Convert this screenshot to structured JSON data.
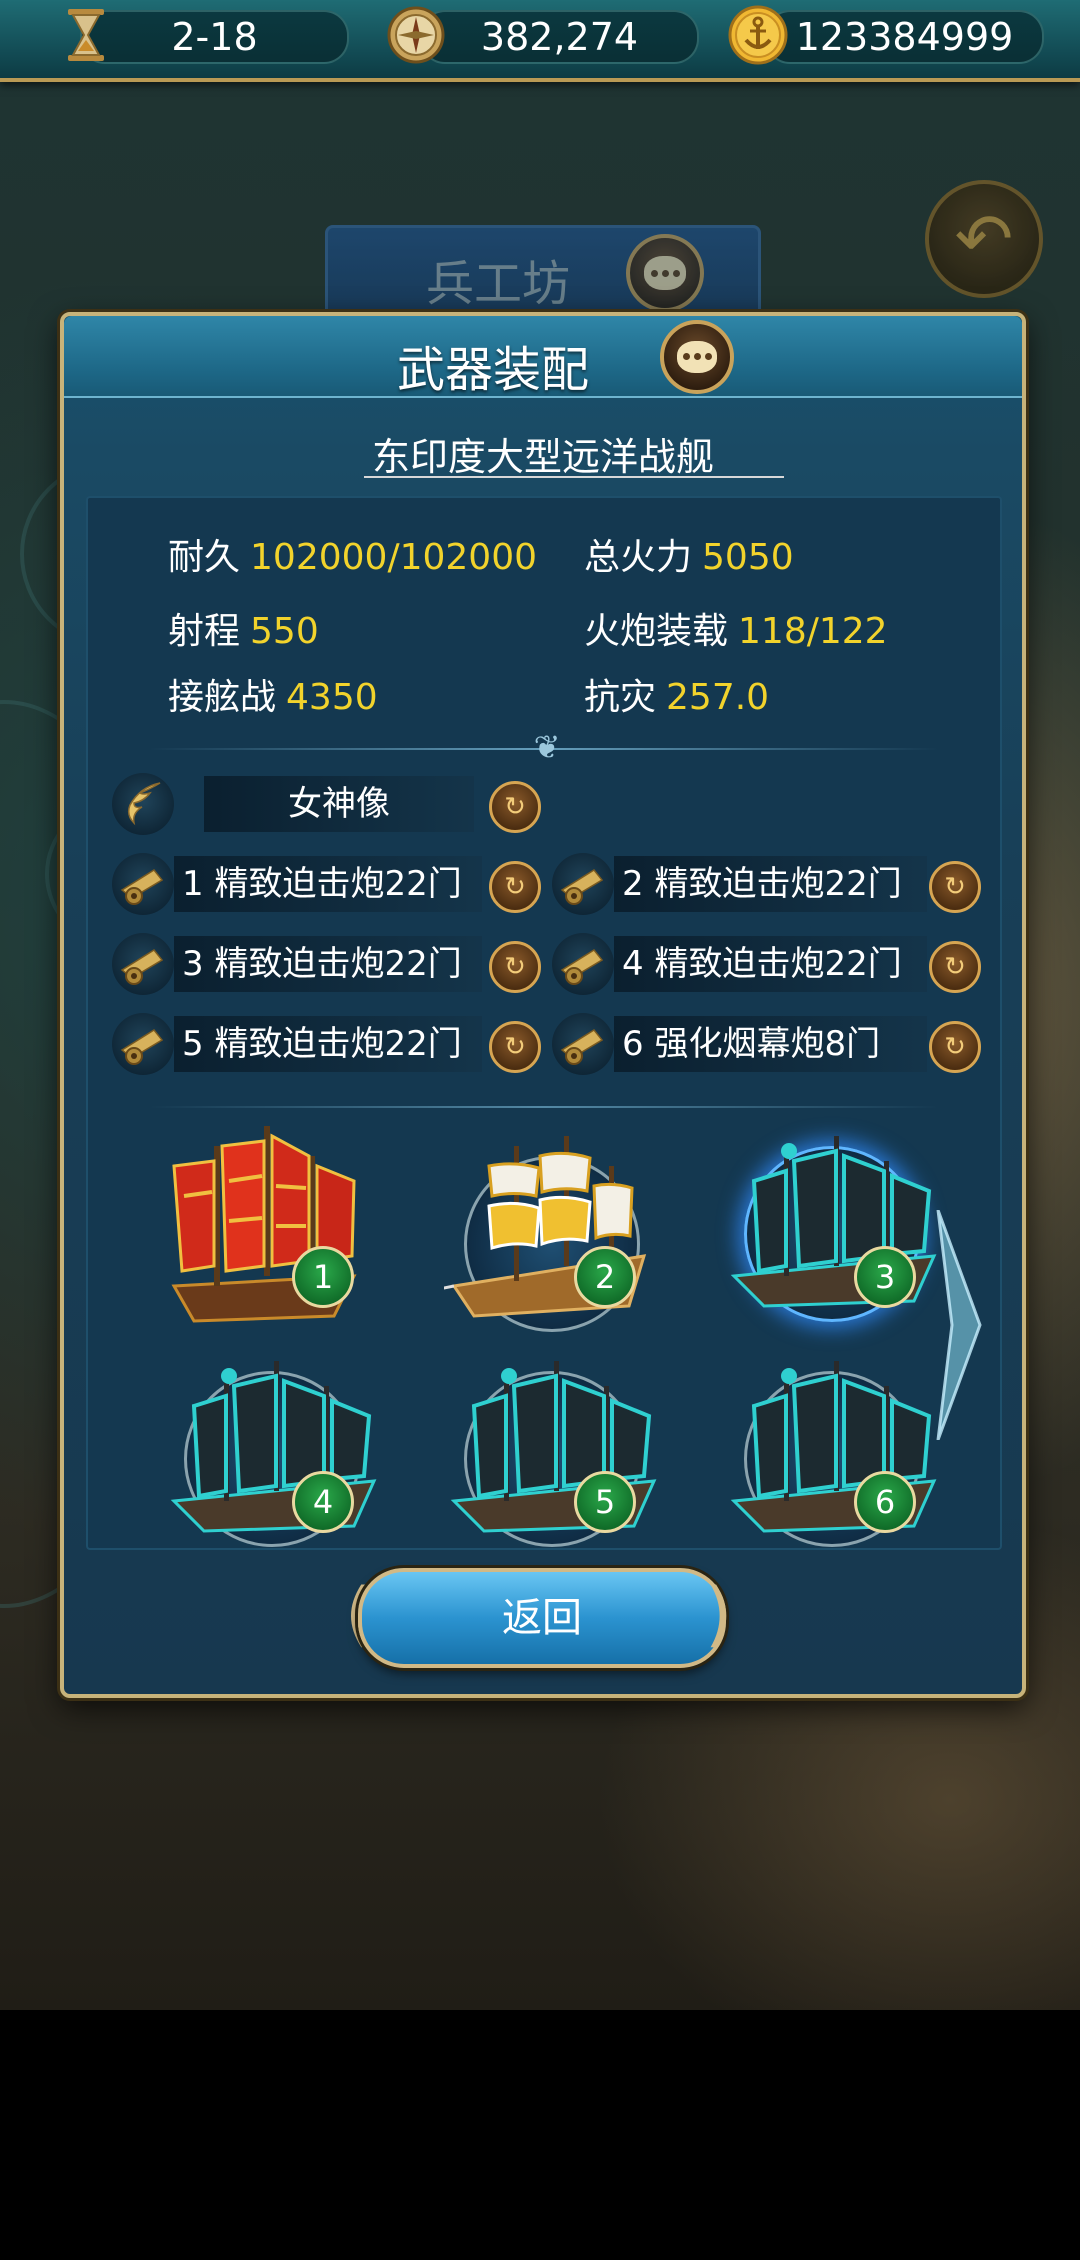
{
  "topbar": {
    "date": "2-18",
    "compass_value": "382,274",
    "gold_value": "123384999",
    "date_icon": "hourglass-icon",
    "compass_icon": "compass-icon",
    "gold_icon": "anchor-coin-icon"
  },
  "background": {
    "workshop_title": "兵工坊",
    "back_icon": "back-arrow-icon"
  },
  "panel": {
    "title": "武器装配",
    "ship_name": "东印度大型远洋战舰",
    "stats": {
      "durability_label": "耐久",
      "durability_value": "102000/102000",
      "firepower_label": "总火力",
      "firepower_value": "5050",
      "range_label": "射程",
      "range_value": "550",
      "cannon_load_label": "火炮装载",
      "cannon_load_value": "118/122",
      "boarding_label": "接舷战",
      "boarding_value": "4350",
      "disaster_resist_label": "抗灾",
      "disaster_resist_value": "257.0"
    },
    "figurehead": {
      "label": "女神像",
      "icon": "wing-icon"
    },
    "cannon_slots": [
      {
        "label": "1 精致迫击炮22门"
      },
      {
        "label": "2 精致迫击炮22门"
      },
      {
        "label": "3 精致迫击炮22门"
      },
      {
        "label": "4 精致迫击炮22门"
      },
      {
        "label": "5 精致迫击炮22门"
      },
      {
        "label": "6 强化烟幕炮8门"
      }
    ],
    "fleet": [
      {
        "number": "1",
        "kind": "red-junk",
        "selected": false
      },
      {
        "number": "2",
        "kind": "galleon",
        "selected": false
      },
      {
        "number": "3",
        "kind": "teal-ship",
        "selected": true
      },
      {
        "number": "4",
        "kind": "teal-ship",
        "selected": false
      },
      {
        "number": "5",
        "kind": "teal-ship",
        "selected": false
      },
      {
        "number": "6",
        "kind": "teal-ship",
        "selected": false
      }
    ],
    "return_label": "返回"
  },
  "colors": {
    "stat_value": "#f2d32c",
    "panel_border": "#c7b37a",
    "badge_green": "#1f8a3a",
    "selected_glow": "#5fb6ff"
  }
}
